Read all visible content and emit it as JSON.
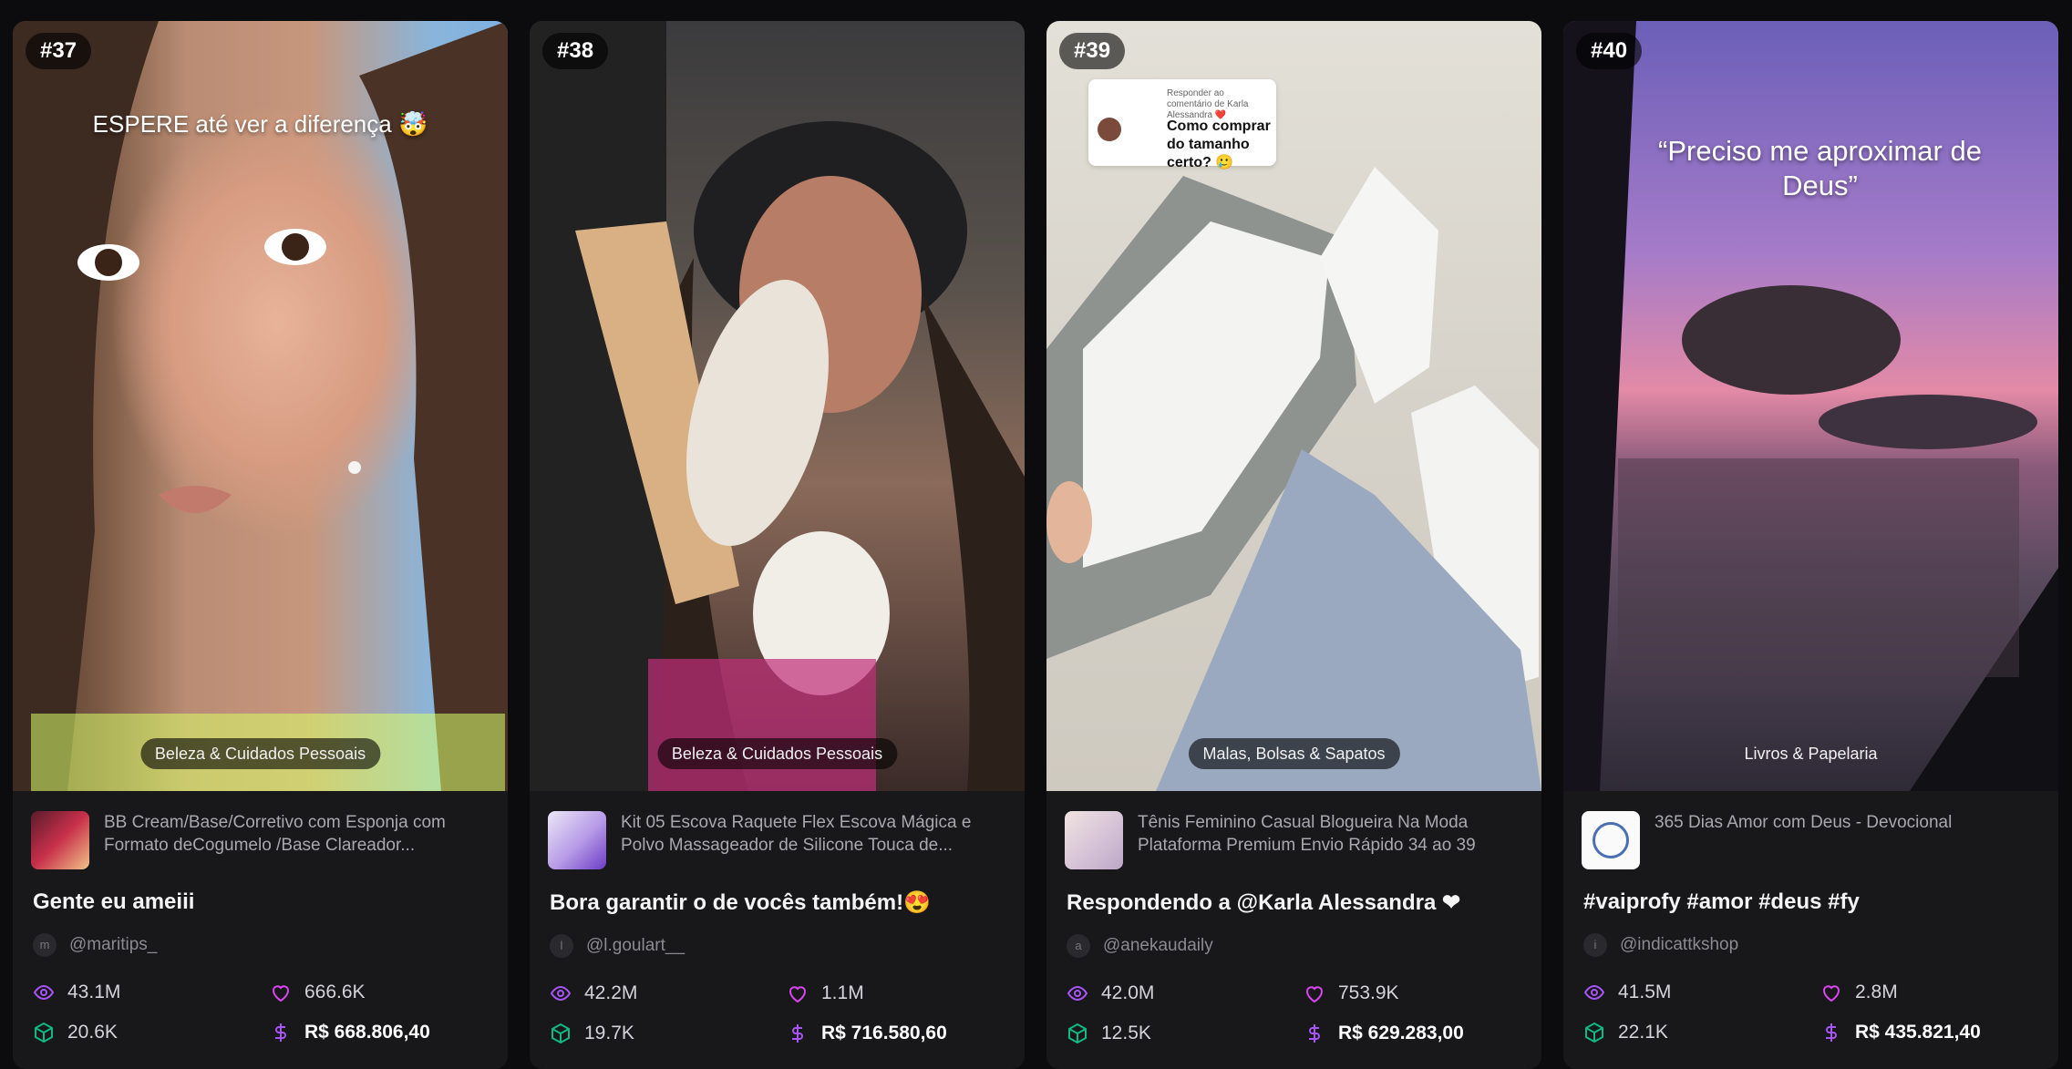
{
  "cards": [
    {
      "rank": "#37",
      "overlay_text": "ESPERE até ver a diferença 🤯",
      "category": "Beleza & Cuidados Pessoais",
      "product_title": "BB Cream/Base/Corretivo com Esponja com Formato deCogumelo /Base Clareador...",
      "video_title": "Gente eu ameiii",
      "author_initial": "m",
      "author": "@maritips_",
      "views": "43.1M",
      "likes": "666.6K",
      "sales": "20.6K",
      "revenue": "R$ 668.806,40"
    },
    {
      "rank": "#38",
      "overlay_text": "",
      "category": "Beleza & Cuidados Pessoais",
      "product_title": "Kit 05 Escova Raquete Flex Escova Mágica e Polvo Massageador de Silicone Touca de...",
      "video_title": "Bora garantir o de vocês também!😍",
      "author_initial": "l",
      "author": "@l.goulart__",
      "views": "42.2M",
      "likes": "1.1M",
      "sales": "19.7K",
      "revenue": "R$ 716.580,60"
    },
    {
      "rank": "#39",
      "overlay_text": "",
      "comment_small": "Responder ao comentário de Karla Alessandra ❤️",
      "comment_main": "Como comprar do tamanho certo? 🥲",
      "category": "Malas, Bolsas & Sapatos",
      "product_title": "Tênis Feminino Casual Blogueira Na Moda Plataforma Premium Envio Rápido 34 ao 39",
      "video_title": "Respondendo a @Karla Alessandra ❤",
      "author_initial": "a",
      "author": "@anekaudaily",
      "views": "42.0M",
      "likes": "753.9K",
      "sales": "12.5K",
      "revenue": "R$ 629.283,00"
    },
    {
      "rank": "#40",
      "overlay_text": "“Preciso me aproximar de Deus”",
      "category": "Livros & Papelaria",
      "product_title": "365 Dias Amor com Deus - Devocional",
      "video_title": "#vaiprofy #amor #deus #fy",
      "author_initial": "i",
      "author": "@indicattkshop",
      "views": "41.5M",
      "likes": "2.8M",
      "sales": "22.1K",
      "revenue": "R$ 435.821,40"
    }
  ],
  "colors": {
    "icon_purple": "#a855f7",
    "icon_pink": "#d946ef",
    "icon_teal": "#10b981"
  }
}
